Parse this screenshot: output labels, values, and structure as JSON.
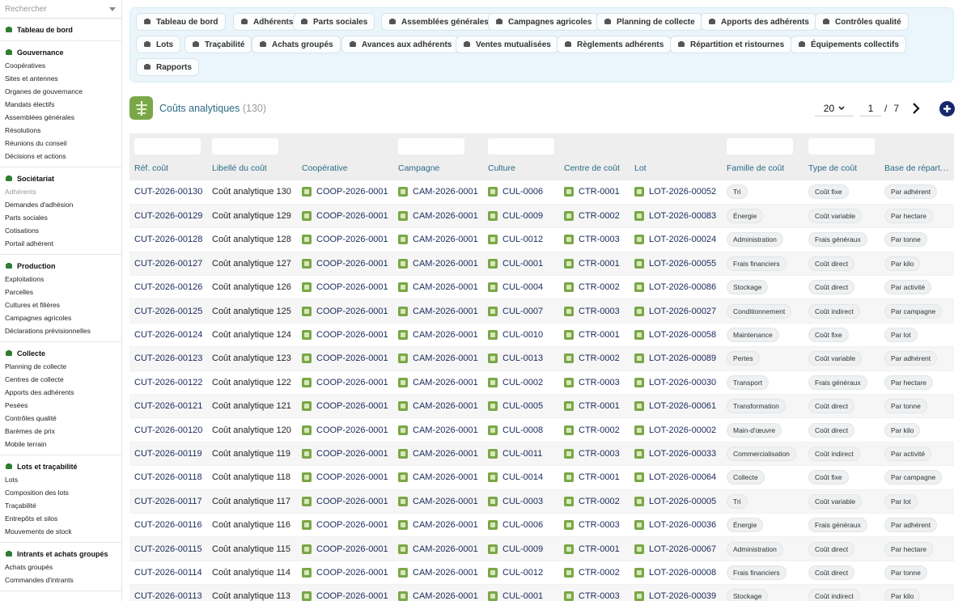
{
  "search": {
    "placeholder": "Rechercher"
  },
  "sidebar": [
    {
      "title": "Tableau de bord",
      "icon": "dashboard-icon",
      "items": []
    },
    {
      "title": "Gouvernance",
      "icon": "building-icon",
      "items": [
        {
          "label": "Coopératives"
        },
        {
          "label": "Sites et antennes"
        },
        {
          "label": "Organes de gouvernance"
        },
        {
          "label": "Mandats électifs"
        },
        {
          "label": "Assemblées générales"
        },
        {
          "label": "Résolutions"
        },
        {
          "label": "Réunions du conseil"
        },
        {
          "label": "Décisions et actions"
        }
      ]
    },
    {
      "title": "Sociétariat",
      "icon": "users-icon",
      "items": [
        {
          "label": "Adhérents",
          "dim": true
        },
        {
          "label": "Demandes d'adhésion"
        },
        {
          "label": "Parts sociales"
        },
        {
          "label": "Cotisations"
        },
        {
          "label": "Portail adhérent"
        }
      ]
    },
    {
      "title": "Production",
      "icon": "leaf-icon",
      "items": [
        {
          "label": "Exploitations"
        },
        {
          "label": "Parcelles"
        },
        {
          "label": "Cultures et filières"
        },
        {
          "label": "Campagnes agricoles"
        },
        {
          "label": "Déclarations prévisionnelles"
        }
      ]
    },
    {
      "title": "Collecte",
      "icon": "truck-icon",
      "items": [
        {
          "label": "Planning de collecte"
        },
        {
          "label": "Centres de collecte"
        },
        {
          "label": "Apports des adhérents"
        },
        {
          "label": "Pesées"
        },
        {
          "label": "Contrôles qualité"
        },
        {
          "label": "Barèmes de prix"
        },
        {
          "label": "Mobile terrain"
        }
      ]
    },
    {
      "title": "Lots et traçabilité",
      "icon": "boxes-icon",
      "items": [
        {
          "label": "Lots"
        },
        {
          "label": "Composition des lots"
        },
        {
          "label": "Traçabilité"
        },
        {
          "label": "Entrepôts et silos"
        },
        {
          "label": "Mouvements de stock"
        }
      ]
    },
    {
      "title": "Intrants et achats groupés",
      "icon": "cart-icon",
      "items": [
        {
          "label": "Achats groupés"
        },
        {
          "label": "Commandes d'intrants"
        }
      ]
    }
  ],
  "toolbar": [
    {
      "label": "Tableau de bord",
      "icon": "dashboard-icon"
    },
    {
      "label": "Adhérents",
      "icon": "user-icon"
    },
    {
      "label": "Parts sociales",
      "icon": "certificate-icon"
    },
    {
      "label": "Assemblées générales",
      "icon": "users-icon"
    },
    {
      "label": "Campagnes agricoles",
      "icon": "calendar-icon"
    },
    {
      "label": "Planning de collecte",
      "icon": "route-icon"
    },
    {
      "label": "Apports des adhérents",
      "icon": "truck-icon"
    },
    {
      "label": "Contrôles qualité",
      "icon": "checklist-icon"
    },
    {
      "label": "Lots",
      "icon": "boxes-icon"
    },
    {
      "label": "Traçabilité",
      "icon": "barcode-icon"
    },
    {
      "label": "Achats groupés",
      "icon": "cart-icon"
    },
    {
      "label": "Avances aux adhérents",
      "icon": "handshake-icon"
    },
    {
      "label": "Ventes mutualisées",
      "icon": "store-icon"
    },
    {
      "label": "Règlements adhérents",
      "icon": "money-icon"
    },
    {
      "label": "Répartition et ristournes",
      "icon": "scale-icon"
    },
    {
      "label": "Équipements collectifs",
      "icon": "tools-icon"
    },
    {
      "label": "Rapports",
      "icon": "chart-pie-icon"
    }
  ],
  "page": {
    "title": "Coûts analytiques",
    "count": "(130)",
    "icon": "cost-tree-icon"
  },
  "pager": {
    "page_size": "20",
    "page": "1",
    "sep": "/",
    "total_pages": "7",
    "next_icon": "chevron-right-icon",
    "add_icon": "plus-circle-icon"
  },
  "table": {
    "columns": [
      "Réf. coût",
      "Libellé du coût",
      "Coopérative",
      "Campagne",
      "Culture",
      "Centre de coût",
      "Lot",
      "Famille de coût",
      "Type de coût",
      "Base de répartition"
    ],
    "rows": [
      [
        "CUT-2026-00130",
        "Coût analytique 130",
        "COOP-2026-0001",
        "CAM-2026-0001",
        "CUL-0006",
        "CTR-0001",
        "LOT-2026-00052",
        "Tri",
        "Coût fixe",
        "Par adhérent"
      ],
      [
        "CUT-2026-00129",
        "Coût analytique 129",
        "COOP-2026-0001",
        "CAM-2026-0001",
        "CUL-0009",
        "CTR-0002",
        "LOT-2026-00083",
        "Énergie",
        "Coût variable",
        "Par hectare"
      ],
      [
        "CUT-2026-00128",
        "Coût analytique 128",
        "COOP-2026-0001",
        "CAM-2026-0001",
        "CUL-0012",
        "CTR-0003",
        "LOT-2026-00024",
        "Administration",
        "Frais généraux",
        "Par tonne"
      ],
      [
        "CUT-2026-00127",
        "Coût analytique 127",
        "COOP-2026-0001",
        "CAM-2026-0001",
        "CUL-0001",
        "CTR-0001",
        "LOT-2026-00055",
        "Frais financiers",
        "Coût direct",
        "Par kilo"
      ],
      [
        "CUT-2026-00126",
        "Coût analytique 126",
        "COOP-2026-0001",
        "CAM-2026-0001",
        "CUL-0004",
        "CTR-0002",
        "LOT-2026-00086",
        "Stockage",
        "Coût direct",
        "Par activité"
      ],
      [
        "CUT-2026-00125",
        "Coût analytique 125",
        "COOP-2026-0001",
        "CAM-2026-0001",
        "CUL-0007",
        "CTR-0003",
        "LOT-2026-00027",
        "Conditionnement",
        "Coût indirect",
        "Par campagne"
      ],
      [
        "CUT-2026-00124",
        "Coût analytique 124",
        "COOP-2026-0001",
        "CAM-2026-0001",
        "CUL-0010",
        "CTR-0001",
        "LOT-2026-00058",
        "Maintenance",
        "Coût fixe",
        "Par lot"
      ],
      [
        "CUT-2026-00123",
        "Coût analytique 123",
        "COOP-2026-0001",
        "CAM-2026-0001",
        "CUL-0013",
        "CTR-0002",
        "LOT-2026-00089",
        "Pertes",
        "Coût variable",
        "Par adhérent"
      ],
      [
        "CUT-2026-00122",
        "Coût analytique 122",
        "COOP-2026-0001",
        "CAM-2026-0001",
        "CUL-0002",
        "CTR-0003",
        "LOT-2026-00030",
        "Transport",
        "Frais généraux",
        "Par hectare"
      ],
      [
        "CUT-2026-00121",
        "Coût analytique 121",
        "COOP-2026-0001",
        "CAM-2026-0001",
        "CUL-0005",
        "CTR-0001",
        "LOT-2026-00061",
        "Transformation",
        "Coût direct",
        "Par tonne"
      ],
      [
        "CUT-2026-00120",
        "Coût analytique 120",
        "COOP-2026-0001",
        "CAM-2026-0001",
        "CUL-0008",
        "CTR-0002",
        "LOT-2026-00002",
        "Main-d'œuvre",
        "Coût direct",
        "Par kilo"
      ],
      [
        "CUT-2026-00119",
        "Coût analytique 119",
        "COOP-2026-0001",
        "CAM-2026-0001",
        "CUL-0011",
        "CTR-0003",
        "LOT-2026-00033",
        "Commercialisation",
        "Coût indirect",
        "Par activité"
      ],
      [
        "CUT-2026-00118",
        "Coût analytique 118",
        "COOP-2026-0001",
        "CAM-2026-0001",
        "CUL-0014",
        "CTR-0001",
        "LOT-2026-00064",
        "Collecte",
        "Coût fixe",
        "Par campagne"
      ],
      [
        "CUT-2026-00117",
        "Coût analytique 117",
        "COOP-2026-0001",
        "CAM-2026-0001",
        "CUL-0003",
        "CTR-0002",
        "LOT-2026-00005",
        "Tri",
        "Coût variable",
        "Par lot"
      ],
      [
        "CUT-2026-00116",
        "Coût analytique 116",
        "COOP-2026-0001",
        "CAM-2026-0001",
        "CUL-0006",
        "CTR-0003",
        "LOT-2026-00036",
        "Énergie",
        "Frais généraux",
        "Par adhérent"
      ],
      [
        "CUT-2026-00115",
        "Coût analytique 115",
        "COOP-2026-0001",
        "CAM-2026-0001",
        "CUL-0009",
        "CTR-0001",
        "LOT-2026-00067",
        "Administration",
        "Coût direct",
        "Par hectare"
      ],
      [
        "CUT-2026-00114",
        "Coût analytique 114",
        "COOP-2026-0001",
        "CAM-2026-0001",
        "CUL-0012",
        "CTR-0002",
        "LOT-2026-00008",
        "Frais financiers",
        "Coût direct",
        "Par tonne"
      ],
      [
        "CUT-2026-00113",
        "Coût analytique 113",
        "COOP-2026-0001",
        "CAM-2026-0001",
        "CUL-0001",
        "CTR-0003",
        "LOT-2026-00039",
        "Stockage",
        "Coût indirect",
        "Par kilo"
      ]
    ]
  }
}
